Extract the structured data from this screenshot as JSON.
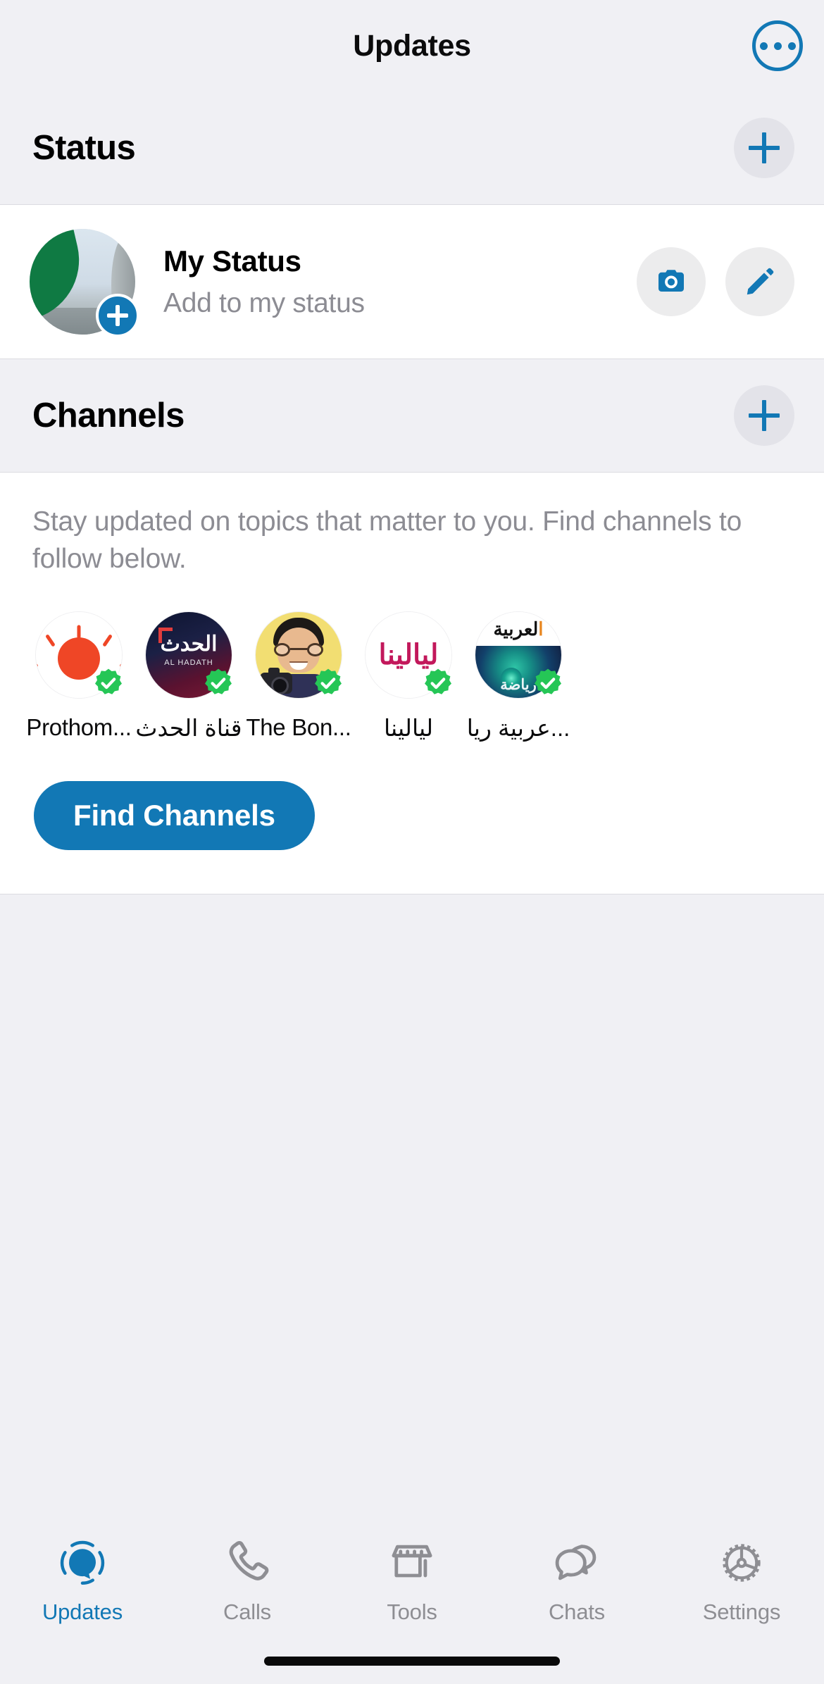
{
  "header": {
    "title": "Updates",
    "more_icon": "more-horizontal-circle-icon"
  },
  "status_section": {
    "title": "Status",
    "add_icon": "plus-icon",
    "my_status": {
      "name": "My Status",
      "subtitle": "Add to my status",
      "avatar_badge_icon": "plus-icon",
      "camera_icon": "camera-icon",
      "pencil_icon": "pencil-icon"
    }
  },
  "channels_section": {
    "title": "Channels",
    "add_icon": "plus-icon",
    "description": "Stay updated on topics that matter to you. Find channels to follow below.",
    "find_button_label": "Find Channels",
    "channels": [
      {
        "name": "Prothom...",
        "art": "sun",
        "verified": true,
        "verified_icon": "verified-badge-icon"
      },
      {
        "name": "قناة الحدث",
        "art": "hadath",
        "verified": true,
        "verified_icon": "verified-badge-icon"
      },
      {
        "name": "The Bon...",
        "art": "bon",
        "verified": true,
        "verified_icon": "verified-badge-icon"
      },
      {
        "name": "ليالينا",
        "art": "layalina",
        "verified": true,
        "verified_icon": "verified-badge-icon",
        "logo_text": "ليالينا"
      },
      {
        "name": "عربية ريا...",
        "art": "arabiya",
        "verified": true,
        "verified_icon": "verified-badge-icon",
        "logo_top": "العربية",
        "logo_bottom": "رياضة"
      }
    ]
  },
  "tabbar": {
    "tabs": [
      {
        "label": "Updates",
        "icon": "updates-icon",
        "active": true
      },
      {
        "label": "Calls",
        "icon": "phone-icon",
        "active": false
      },
      {
        "label": "Tools",
        "icon": "storefront-icon",
        "active": false
      },
      {
        "label": "Chats",
        "icon": "chat-bubbles-icon",
        "active": false
      },
      {
        "label": "Settings",
        "icon": "gear-icon",
        "active": false
      }
    ]
  },
  "colors": {
    "accent": "#1278b5",
    "background": "#f0f0f4",
    "card": "#ffffff",
    "verified_green": "#25c656",
    "muted_text": "#8c8c93"
  }
}
